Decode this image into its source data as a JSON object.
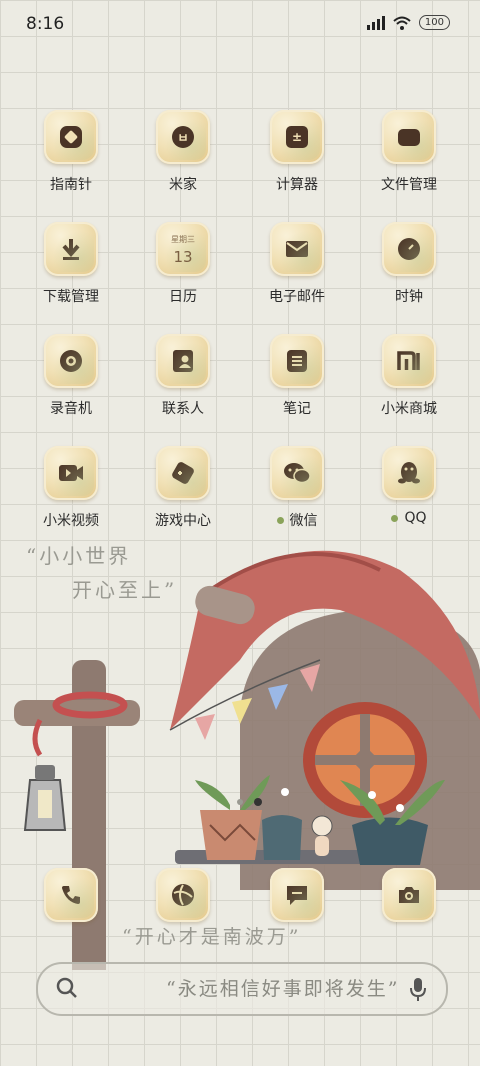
{
  "status": {
    "time": "8:16",
    "battery": "100"
  },
  "apps": [
    {
      "label": "指南针"
    },
    {
      "label": "米家"
    },
    {
      "label": "计算器"
    },
    {
      "label": "文件管理"
    },
    {
      "label": "下载管理"
    },
    {
      "label": "日历",
      "cal_top": "星期三",
      "cal_num": "13"
    },
    {
      "label": "电子邮件"
    },
    {
      "label": "时钟"
    },
    {
      "label": "录音机"
    },
    {
      "label": "联系人"
    },
    {
      "label": "笔记"
    },
    {
      "label": "小米商城"
    },
    {
      "label": "小米视频"
    },
    {
      "label": "游戏中心"
    },
    {
      "label": "微信"
    },
    {
      "label": "QQ"
    }
  ],
  "wallpaper": {
    "line1": "“小小世界",
    "line2": "开心至上”",
    "line3": "“开心才是南波万”"
  },
  "dock": [
    "phone-icon",
    "browser-icon",
    "messages-icon",
    "camera-icon"
  ],
  "search": {
    "text": "“永远相信好事即将发生”"
  }
}
